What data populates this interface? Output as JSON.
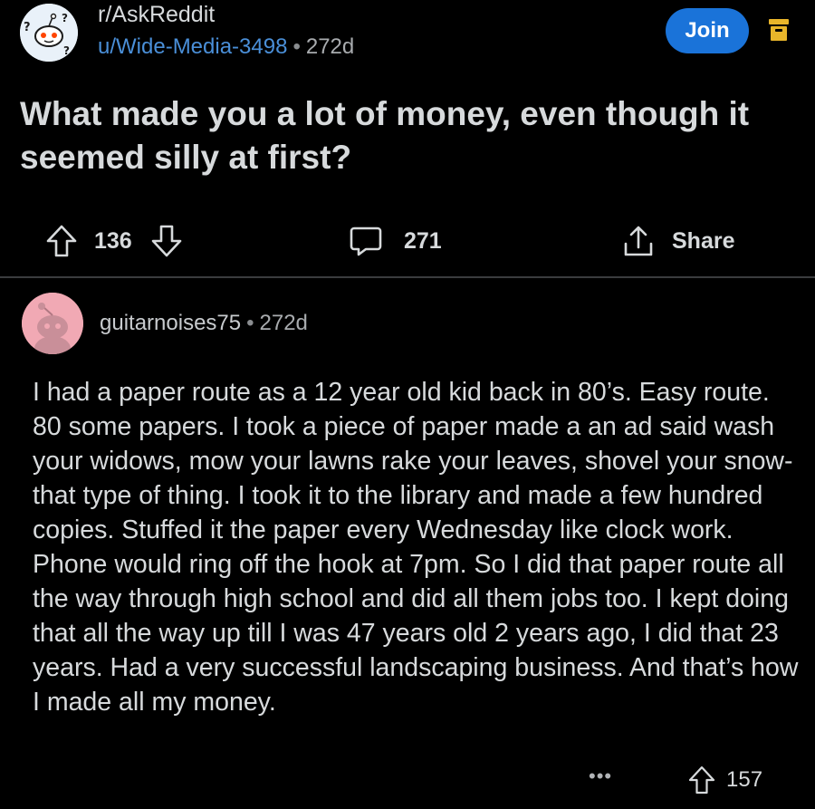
{
  "post": {
    "subreddit": "r/AskReddit",
    "author": "u/Wide-Media-3498",
    "separator": "•",
    "age": "272d",
    "join_label": "Join",
    "title": "What made you a lot of money, even though it seemed silly at first?",
    "score": "136",
    "comments": "271",
    "share_label": "Share"
  },
  "comment": {
    "author": "guitarnoises75",
    "separator": "•",
    "age": "272d",
    "body": "I had a paper route as a 12 year old kid back in 80’s. Easy route. 80 some papers. I took a piece of paper made a an ad said wash your widows, mow your lawns rake your leaves, shovel your snow- that type of thing. I took it to the library and made a few hundred copies. Stuffed it the paper every Wednesday like clock work. Phone would ring off the hook at 7pm. So I did that paper route all the way through high school and did all them jobs too. I kept doing that all the way up till I was 47 years old 2 years ago, I did that 23 years. Had a very successful landscaping business. And that’s how I made all my money.",
    "more_label": "•••",
    "score": "157"
  },
  "icons": {
    "subreddit_avatar": "askreddit-snoo-icon",
    "archive": "archive-icon",
    "upvote": "upvote-arrow-icon",
    "downvote": "downvote-arrow-icon",
    "comment": "speech-bubble-icon",
    "share": "share-upload-icon",
    "user_avatar": "snoo-avatar-icon"
  },
  "colors": {
    "background": "#000000",
    "text": "#d7dadc",
    "link_blue": "#4a8fd8",
    "join_button": "#1a73d9",
    "archive_icon": "#e8b52a",
    "comment_avatar_bg": "#f1a9b4",
    "divider": "#3a3c3e"
  }
}
